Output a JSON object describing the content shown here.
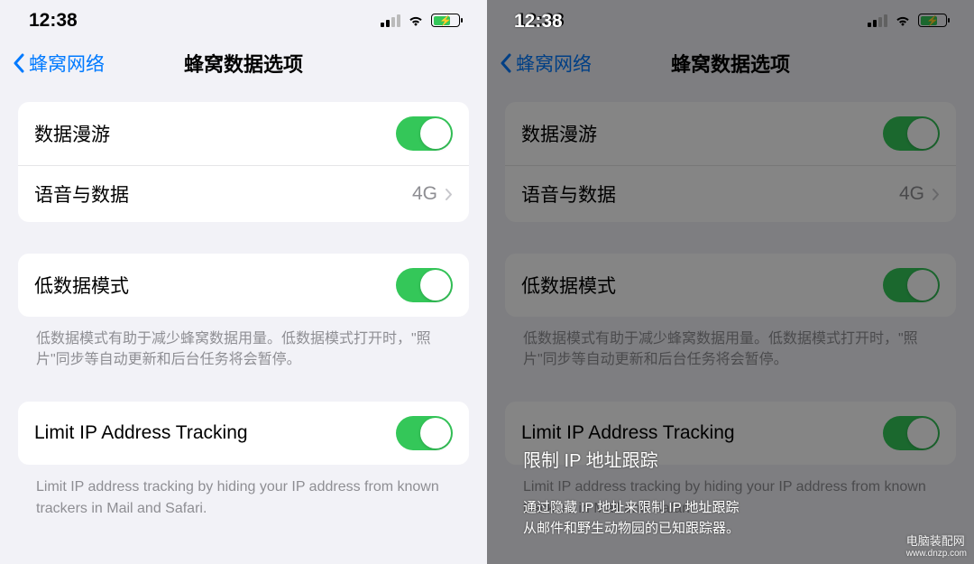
{
  "left": {
    "statusbar": {
      "time": "12:38"
    },
    "nav": {
      "back": "蜂窝网络",
      "title": "蜂窝数据选项"
    },
    "section1": {
      "row1_label": "数据漫游",
      "row2_label": "语音与数据",
      "row2_value": "4G"
    },
    "section2": {
      "row1_label": "低数据模式",
      "footer": "低数据模式有助于减少蜂窝数据用量。低数据模式打开时，\"照片\"同步等自动更新和后台任务将会暂停。"
    },
    "section3": {
      "row1_label": "Limit IP Address Tracking",
      "footer": "Limit IP address tracking by hiding your IP address from known trackers in Mail and Safari."
    }
  },
  "right": {
    "statusbar": {
      "time": "12:38"
    },
    "nav": {
      "back": "蜂窝网络",
      "title": "蜂窝数据选项"
    },
    "section1": {
      "row1_label": "数据漫游",
      "row2_label": "语音与数据",
      "row2_value": "4G"
    },
    "section2": {
      "row1_label": "低数据模式",
      "footer": "低数据模式有助于减少蜂窝数据用量。低数据模式打开时，\"照片\"同步等自动更新和后台任务将会暂停。"
    },
    "section3": {
      "row1_label": "Limit IP Address Tracking",
      "footer": "Limit IP address tracking by hiding your IP address from known trackers in Mail and Safari."
    },
    "tooltip": {
      "time": "12:38",
      "title": "限制 IP 地址跟踪",
      "desc": "通过隐藏 IP 地址来限制 IP 地址跟踪\n从邮件和野生动物园的已知跟踪器。"
    }
  },
  "watermark": {
    "main": "电脑装配网",
    "sub": "www.dnzp.com"
  }
}
